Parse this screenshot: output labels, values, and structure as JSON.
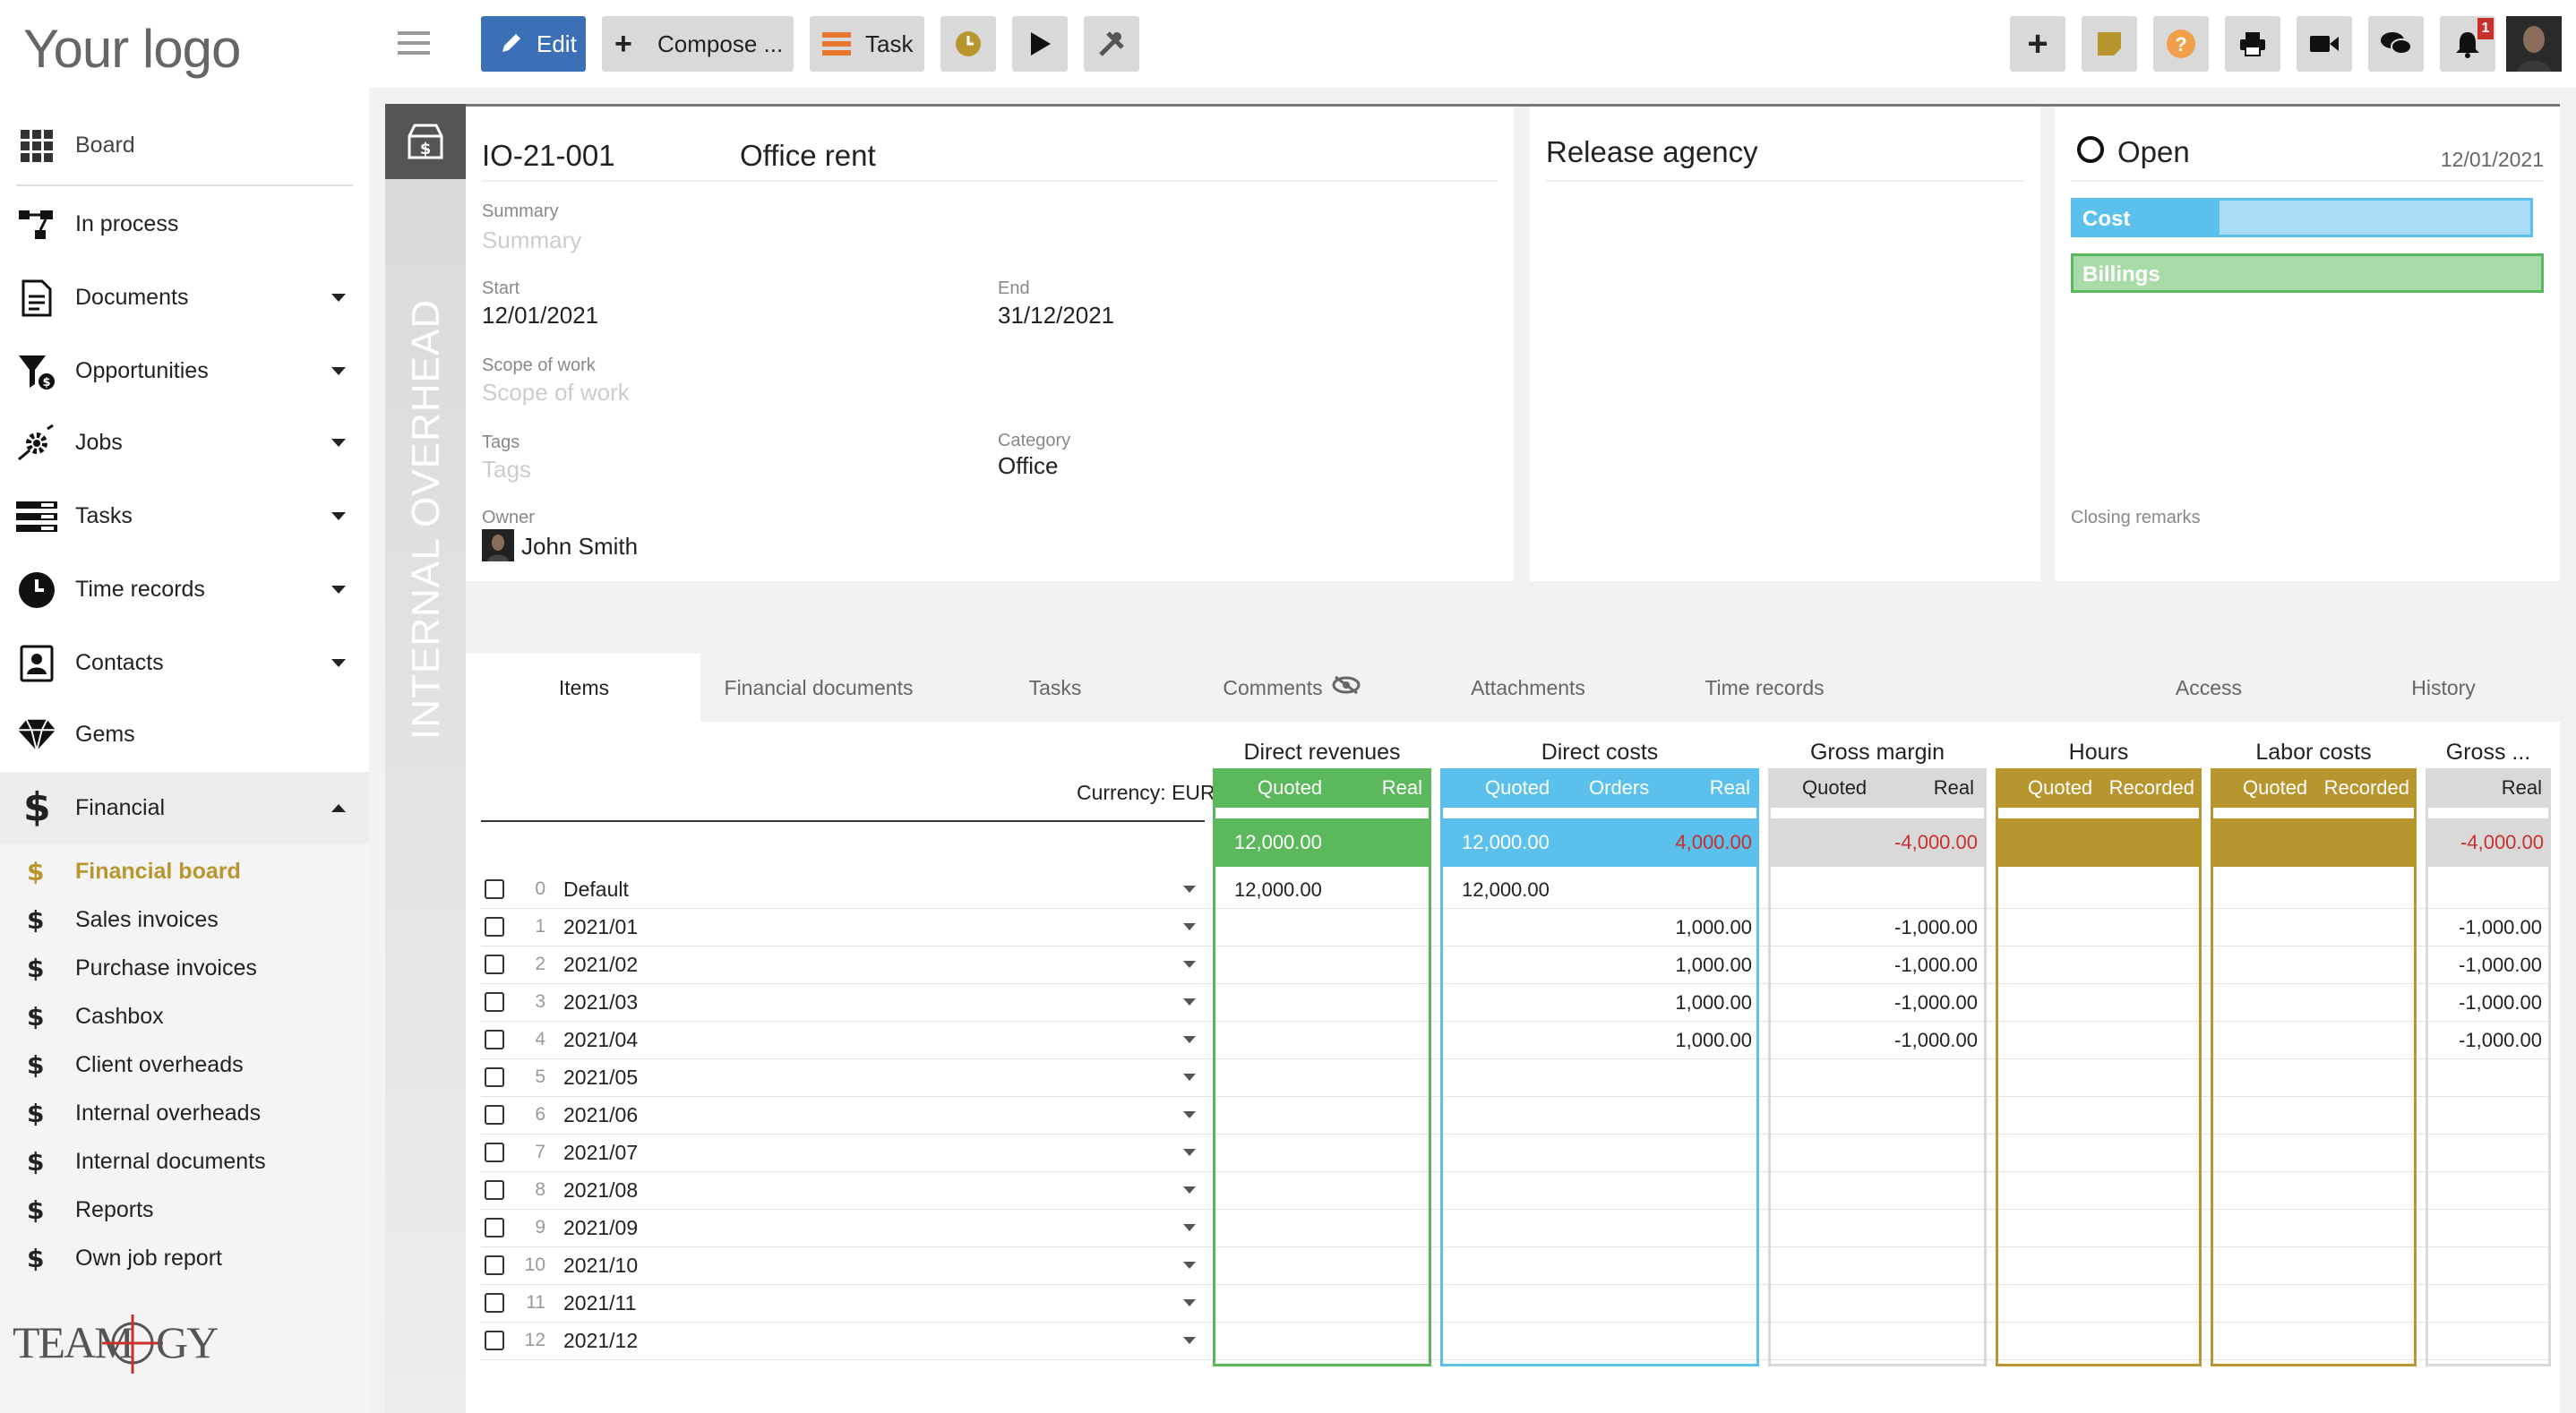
{
  "brand": {
    "logo": "Your logo",
    "footer_logo": "TEAMOGY"
  },
  "sidebar": {
    "board": "Board",
    "items": [
      {
        "label": "In process",
        "caret": false
      },
      {
        "label": "Documents",
        "caret": true
      },
      {
        "label": "Opportunities",
        "caret": true
      },
      {
        "label": "Jobs",
        "caret": true
      },
      {
        "label": "Tasks",
        "caret": true
      },
      {
        "label": "Time records",
        "caret": true
      },
      {
        "label": "Contacts",
        "caret": true
      },
      {
        "label": "Gems",
        "caret": false
      }
    ],
    "financial": "Financial",
    "financial_sub": [
      "Financial board",
      "Sales invoices",
      "Purchase invoices",
      "Cashbox",
      "Client overheads",
      "Internal overheads",
      "Internal documents",
      "Reports",
      "Own job report"
    ]
  },
  "toolbar": {
    "edit": "Edit",
    "compose": "Compose ...",
    "task": "Task",
    "notif_count": "1"
  },
  "record": {
    "vertical_label": "INTERNAL OVERHEAD",
    "id": "IO-21-001",
    "title": "Office rent",
    "summary_label": "Summary",
    "summary_placeholder": "Summary",
    "start_label": "Start",
    "start": "12/01/2021",
    "end_label": "End",
    "end": "31/12/2021",
    "scope_label": "Scope of work",
    "scope_placeholder": "Scope of work",
    "tags_label": "Tags",
    "tags_placeholder": "Tags",
    "category_label": "Category",
    "category": "Office",
    "owner_label": "Owner",
    "owner": "John Smith"
  },
  "release": {
    "title": "Release agency"
  },
  "status": {
    "state": "Open",
    "date": "12/01/2021",
    "cost_label": "Cost",
    "cost_fill": 0.32,
    "billings_label": "Billings",
    "closing_remarks": "Closing remarks"
  },
  "tabs": [
    "Items",
    "Financial documents",
    "Tasks",
    "Comments",
    "Attachments",
    "Time records",
    "Access",
    "History"
  ],
  "items": {
    "currency": "Currency: EUR",
    "groups": {
      "direct_revenues": "Direct revenues",
      "direct_costs": "Direct costs",
      "gross_margin": "Gross margin",
      "hours": "Hours",
      "labor_costs": "Labor costs",
      "gross_trunc": "Gross ..."
    },
    "sub": {
      "quoted": "Quoted",
      "real": "Real",
      "orders": "Orders",
      "recorded": "Recorded"
    },
    "summary": {
      "rev_quoted": "12,000.00",
      "cost_quoted": "12,000.00",
      "cost_real": "4,000.00",
      "margin_real": "-4,000.00",
      "gross_real": "-4,000.00"
    },
    "rows": [
      {
        "n": "0",
        "name": "Default",
        "rev": "12,000.00",
        "cq": "12,000.00",
        "cr": "",
        "gm": "",
        "g2": ""
      },
      {
        "n": "1",
        "name": "2021/01",
        "rev": "",
        "cq": "",
        "cr": "1,000.00",
        "gm": "-1,000.00",
        "g2": "-1,000.00"
      },
      {
        "n": "2",
        "name": "2021/02",
        "rev": "",
        "cq": "",
        "cr": "1,000.00",
        "gm": "-1,000.00",
        "g2": "-1,000.00"
      },
      {
        "n": "3",
        "name": "2021/03",
        "rev": "",
        "cq": "",
        "cr": "1,000.00",
        "gm": "-1,000.00",
        "g2": "-1,000.00"
      },
      {
        "n": "4",
        "name": "2021/04",
        "rev": "",
        "cq": "",
        "cr": "1,000.00",
        "gm": "-1,000.00",
        "g2": "-1,000.00"
      },
      {
        "n": "5",
        "name": "2021/05",
        "rev": "",
        "cq": "",
        "cr": "",
        "gm": "",
        "g2": ""
      },
      {
        "n": "6",
        "name": "2021/06",
        "rev": "",
        "cq": "",
        "cr": "",
        "gm": "",
        "g2": ""
      },
      {
        "n": "7",
        "name": "2021/07",
        "rev": "",
        "cq": "",
        "cr": "",
        "gm": "",
        "g2": ""
      },
      {
        "n": "8",
        "name": "2021/08",
        "rev": "",
        "cq": "",
        "cr": "",
        "gm": "",
        "g2": ""
      },
      {
        "n": "9",
        "name": "2021/09",
        "rev": "",
        "cq": "",
        "cr": "",
        "gm": "",
        "g2": ""
      },
      {
        "n": "10",
        "name": "2021/10",
        "rev": "",
        "cq": "",
        "cr": "",
        "gm": "",
        "g2": ""
      },
      {
        "n": "11",
        "name": "2021/11",
        "rev": "",
        "cq": "",
        "cr": "",
        "gm": "",
        "g2": ""
      },
      {
        "n": "12",
        "name": "2021/12",
        "rev": "",
        "cq": "",
        "cr": "",
        "gm": "",
        "g2": ""
      }
    ]
  },
  "colors": {
    "green": "#5cb85c",
    "blue": "#5bc0eb",
    "gold": "#b8962e",
    "grey": "#d9d9d9",
    "red": "#c9302c",
    "edit_blue": "#3b6fb6"
  }
}
